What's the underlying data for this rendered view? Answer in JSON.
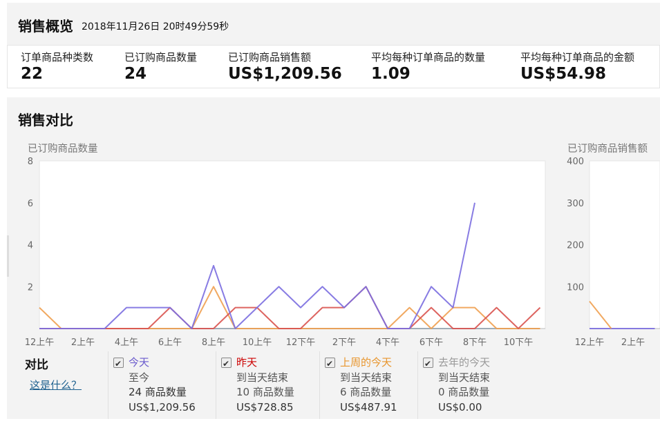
{
  "summary": {
    "title": "销售概览",
    "timestamp": "2018年11月26日 20时49分59秒",
    "metrics": [
      {
        "label": "订单商品种类数",
        "value": "22"
      },
      {
        "label": "已订购商品数量",
        "value": "24"
      },
      {
        "label": "已订购商品销售额",
        "value": "US$1,209.56"
      },
      {
        "label": "平均每种订单商品的数量",
        "value": "1.09"
      },
      {
        "label": "平均每种订单商品的金额",
        "value": "US$54.98"
      }
    ]
  },
  "compare": {
    "title": "销售对比",
    "legend_title": "对比",
    "help_link": "这是什么？",
    "legend": [
      {
        "name": "今天",
        "period": "至今",
        "units": "24 商品数量",
        "sales": "US$1,209.56",
        "color": "#6a5acd"
      },
      {
        "name": "昨天",
        "period": "到当天结束",
        "units": "10 商品数量",
        "sales": "US$728.85",
        "color": "#cc0000"
      },
      {
        "name": "上周的今天",
        "period": "到当天结束",
        "units": "6 商品数量",
        "sales": "US$487.91",
        "color": "#e8952c"
      },
      {
        "name": "去年的今天",
        "period": "到当天结束",
        "units": "0 商品数量",
        "sales": "US$0.00",
        "color": "#999999"
      }
    ]
  },
  "chart_data": [
    {
      "type": "line",
      "ylabel": "已订购商品数量",
      "ylim": [
        0,
        8
      ],
      "yticks": [
        2,
        4,
        6,
        8
      ],
      "x_tick_labels": [
        "12上午",
        "2上午",
        "4上午",
        "6上午",
        "8上午",
        "10上午",
        "12下午",
        "2下午",
        "4下午",
        "6下午",
        "8下午",
        "10下午"
      ],
      "grid": false,
      "series": [
        {
          "name": "今天",
          "color": "#7b6ee0",
          "values": [
            0,
            0,
            0,
            0,
            1,
            1,
            1,
            0,
            3,
            0,
            1,
            2,
            1,
            2,
            1,
            2,
            0,
            0,
            2,
            1,
            6
          ]
        },
        {
          "name": "昨天",
          "color": "#d9534f",
          "values": [
            0,
            0,
            0,
            0,
            0,
            0,
            1,
            0,
            0,
            1,
            1,
            0,
            0,
            1,
            1,
            2,
            0,
            0,
            1,
            0,
            0,
            1,
            0,
            1
          ]
        },
        {
          "name": "上周的今天",
          "color": "#f0a050",
          "values": [
            1,
            0,
            0,
            0,
            0,
            0,
            0,
            0,
            2,
            0,
            0,
            0,
            0,
            0,
            0,
            0,
            0,
            1,
            0,
            1,
            1,
            0,
            0,
            0
          ]
        },
        {
          "name": "去年的今天",
          "color": "#9aa7b5",
          "values": [
            0,
            0,
            0,
            0,
            0,
            0,
            0,
            0,
            0,
            0,
            0,
            0,
            0,
            0,
            0,
            0,
            0,
            0,
            0,
            0,
            0,
            0,
            0,
            0
          ]
        }
      ]
    },
    {
      "type": "line",
      "ylabel": "已订购商品销售额",
      "ylim": [
        0,
        400
      ],
      "yticks": [
        100,
        200,
        300,
        400
      ],
      "x_tick_labels": [
        "12上午",
        "2上午"
      ],
      "grid": false,
      "series": [
        {
          "name": "上周的今天",
          "color": "#f0a050",
          "values": [
            65,
            0
          ]
        },
        {
          "name": "今天",
          "color": "#7b6ee0",
          "values": [
            0,
            0,
            0,
            0,
            0
          ]
        }
      ]
    }
  ]
}
